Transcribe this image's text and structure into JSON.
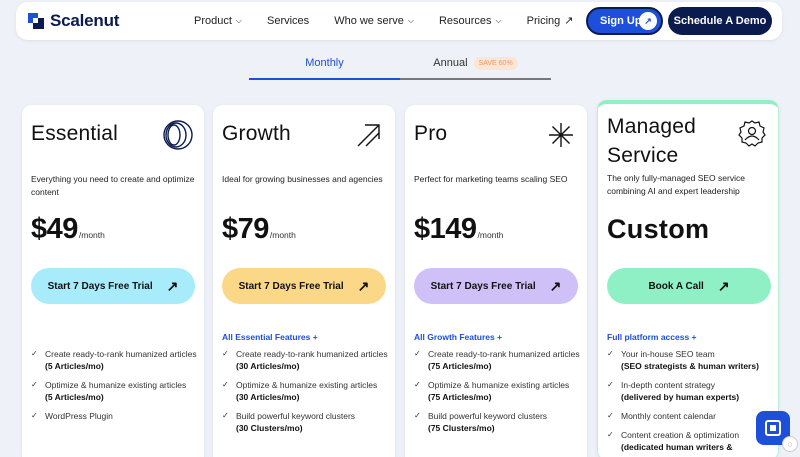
{
  "nav": {
    "logo_text": "Scalenut",
    "links": [
      {
        "label": "Product",
        "icon": "chevron-down-icon"
      },
      {
        "label": "Services",
        "icon": ""
      },
      {
        "label": "Who we serve",
        "icon": "chevron-down-icon"
      },
      {
        "label": "Resources",
        "icon": "chevron-down-icon"
      },
      {
        "label": "Pricing",
        "icon": "arrow-up-right-icon"
      }
    ],
    "signup_label": "Sign Up",
    "demo_label": "Schedule A Demo"
  },
  "billing_tabs": {
    "monthly": "Monthly",
    "annual": "Annual",
    "save_badge": "SAVE 60%",
    "active": "monthly"
  },
  "plans": [
    {
      "title": "Essential",
      "icon": "concentric-circles-icon",
      "description": "Everything you need to create and optimize content",
      "price": "$49",
      "price_unit": "/month",
      "cta": "Start 7 Days Free Trial",
      "cta_color": "#a8ecfb",
      "features_heading": "",
      "features": [
        {
          "text": "Create ready-to-rank humanized articles",
          "note": "(5 Articles/mo)"
        },
        {
          "text": "Optimize & humanize existing articles",
          "note": "(5 Articles/mo)"
        },
        {
          "text": "WordPress Plugin",
          "note": ""
        }
      ]
    },
    {
      "title": "Growth",
      "icon": "arrow-up-right-icon",
      "description": "Ideal for growing businesses and agencies",
      "price": "$79",
      "price_unit": "/month",
      "cta": "Start 7 Days Free Trial",
      "cta_color": "#fbd888",
      "features_heading": "All Essential Features +",
      "features": [
        {
          "text": "Create ready-to-rank humanized articles",
          "note": "(30 Articles/mo)"
        },
        {
          "text": "Optimize & humanize existing articles",
          "note": "(30 Articles/mo)"
        },
        {
          "text": "Build powerful keyword clusters",
          "note": "(30 Clusters/mo)"
        }
      ]
    },
    {
      "title": "Pro",
      "icon": "sparkle-asterisk-icon",
      "description": "Perfect for marketing teams scaling SEO",
      "price": "$149",
      "price_unit": "/month",
      "cta": "Start 7 Days Free Trial",
      "cta_color": "#cfc0f7",
      "features_heading": "All Growth Features +",
      "features": [
        {
          "text": "Create ready-to-rank humanized articles",
          "note": "(75 Articles/mo)"
        },
        {
          "text": "Optimize & humanize existing articles",
          "note": "(75 Articles/mo)"
        },
        {
          "text": "Build powerful keyword clusters",
          "note": "(75 Clusters/mo)"
        }
      ]
    },
    {
      "title": "Managed Service",
      "icon": "gear-person-icon",
      "description": "The only fully-managed SEO service combining AI and expert leadership",
      "price": "Custom",
      "price_unit": "",
      "cta": "Book A Call",
      "cta_color": "#8ff0c5",
      "features_heading": "Full platform access +",
      "features": [
        {
          "text": "Your in-house SEO team",
          "note": "(SEO strategists & human writers)"
        },
        {
          "text": "In-depth content strategy",
          "note": "(delivered by human experts)"
        },
        {
          "text": "Monthly content calendar",
          "note": ""
        },
        {
          "text": "Content creation & optimization",
          "note": "(dedicated human writers &"
        }
      ]
    }
  ]
}
